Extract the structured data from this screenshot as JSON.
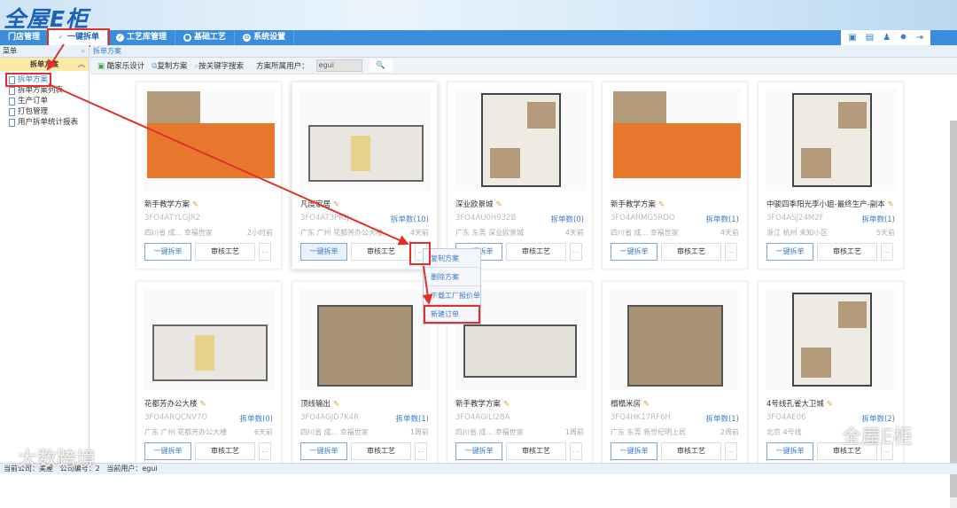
{
  "header": {
    "logo": "全屋E柜"
  },
  "nav": {
    "items": [
      {
        "label": "门店管理",
        "icon": ""
      },
      {
        "label": "一键拆单",
        "icon": "check-icon"
      },
      {
        "label": "工艺库管理",
        "icon": "check-icon"
      },
      {
        "label": "基础工艺",
        "icon": "gear-icon"
      },
      {
        "label": "系统设置",
        "icon": "settings-icon"
      }
    ],
    "tools": [
      "home-icon",
      "calendar-icon",
      "user-icon",
      "gear-icon",
      "logout-icon"
    ]
  },
  "sidebar": {
    "title": "菜单",
    "collapse": "«",
    "group": "拆单方案",
    "group_toggle": "«",
    "items": [
      "拆单方案",
      "拆单方案列表",
      "生产订单",
      "打包管理",
      "用户拆单统计报表"
    ]
  },
  "main": {
    "breadcrumb": "拆单方案",
    "toolbar": {
      "design": "酷家乐设计",
      "copy": "复制方案",
      "keyword": "按关键字搜索",
      "owner_label": "方案所属用户：",
      "owner_value": "egui",
      "search_icon": "🔍"
    }
  },
  "cards": [
    {
      "title": "新手教学方案",
      "code": "3FO4ATYLGJR2",
      "count": "",
      "loc": "四川省 成... 幸福世家",
      "time": "2小时前",
      "img": "orange"
    },
    {
      "title": "凡度家居",
      "code": "3FO4AT3PIGJ",
      "count": "拆单数(10)",
      "loc": "广东 广州 花都芳办公大楼",
      "time": "4天前",
      "img": "office"
    },
    {
      "title": "深业欧景城",
      "code": "3FO4AU0H932B",
      "count": "拆单数(0)",
      "loc": "广东 东莞 深业欧景城",
      "time": "4天前",
      "img": "apartment"
    },
    {
      "title": "新手教学方案",
      "code": "3FO4ARMG5RDO",
      "count": "拆单数(1)",
      "loc": "四川省 成... 幸福世家",
      "time": "4天前",
      "img": "orange"
    },
    {
      "title": "中骏四季阳光李小姐-最终生产-副本",
      "code": "3FO4ASJ24M2F",
      "count": "拆单数(1)",
      "loc": "浙江 杭州 未知小区",
      "time": "5天前",
      "img": "apartment"
    },
    {
      "title": "花都芳办公大楼",
      "code": "3FO4ARQCNV7O",
      "count": "拆单数(0)",
      "loc": "广东 广州 花都芳办公大楼",
      "time": "6天前",
      "img": "office"
    },
    {
      "title": "顶线输出",
      "code": "3FO4AGJD7K4R",
      "count": "拆单数(1)",
      "loc": "四川省 成... 幸福世家",
      "time": "1周前",
      "img": "wood"
    },
    {
      "title": "新手教学方案",
      "code": "3FO4AGILI2BA",
      "count": "",
      "loc": "四川省 成... 幸福世家",
      "time": "1周前",
      "img": "gray"
    },
    {
      "title": "榻榻米房",
      "code": "3FO4HK17RF6H",
      "count": "拆单数(1)",
      "loc": "广东 东莞 新世纪明上居",
      "time": "2周前",
      "img": "wood"
    },
    {
      "title": "4号线孔雀大卫城",
      "code": "3FO4AE06",
      "count": "拆单数(2)",
      "loc": "北京 4号线",
      "time": "",
      "img": "apartment"
    }
  ],
  "card_buttons": {
    "split": "一键拆单",
    "review": "审核工艺",
    "more": "..."
  },
  "context_menu": [
    "复制方案",
    "删除方案",
    "下载工厂报价单",
    "新建订单"
  ],
  "footer": {
    "company": "当前公司：美屋",
    "company_no": "公司编号：2",
    "user": "当前用户：egui"
  },
  "watermarks": {
    "left": "大数跨境",
    "right": "全屋E柜"
  },
  "colors": {
    "nav": "#3a8ddc",
    "accent": "#3a7ec4",
    "highlight": "#e0302a",
    "plan_orange": "#e8772e",
    "plan_wood": "#b39a7a"
  }
}
